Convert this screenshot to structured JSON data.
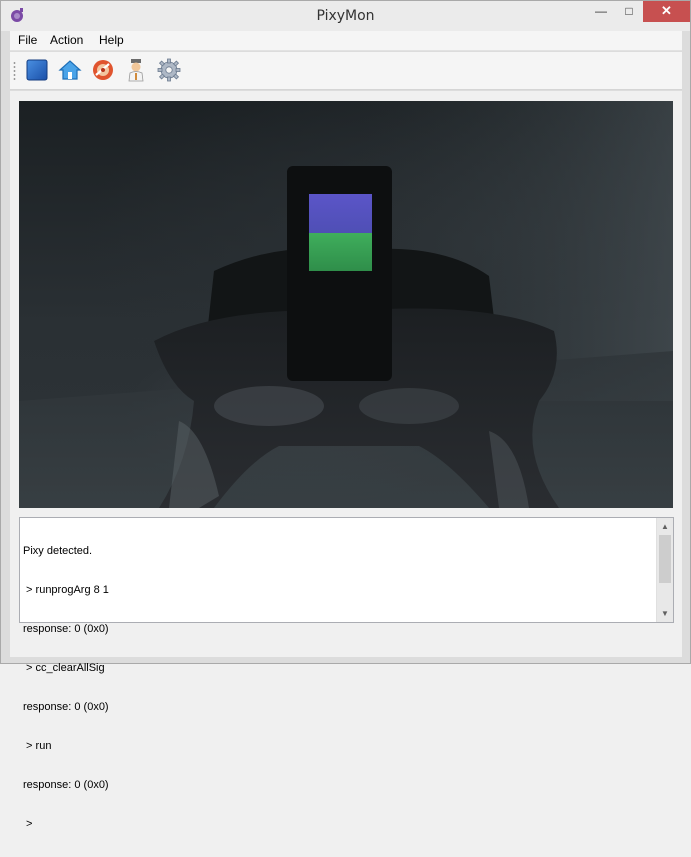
{
  "window": {
    "title": "PixyMon",
    "controls": {
      "minimize": "—",
      "maximize": "□",
      "close": "✕"
    },
    "colors": {
      "close_bg": "#c75050",
      "titlebar_bg": "#ebebeb"
    }
  },
  "menu": {
    "items": [
      {
        "label": "File"
      },
      {
        "label": "Action"
      },
      {
        "label": "Help"
      }
    ]
  },
  "toolbar": {
    "buttons": [
      {
        "icon": "stop-icon",
        "color": "#2266cc"
      },
      {
        "icon": "home-icon",
        "color": "#3b8fd8"
      },
      {
        "icon": "set-signature-icon",
        "color": "#d94f2b"
      },
      {
        "icon": "raw-video-icon",
        "color": "#c89050"
      },
      {
        "icon": "settings-gear-icon",
        "color": "#7a8aa0"
      }
    ]
  },
  "video": {
    "description_colors": {
      "signature_top": "#5b55c8",
      "signature_bottom": "#3fae5c"
    }
  },
  "console": {
    "lines": [
      "Pixy detected.",
      " > runprogArg 8 1",
      "response: 0 (0x0)",
      " > cc_clearAllSig",
      "response: 0 (0x0)",
      " > run",
      "response: 0 (0x0)",
      " > "
    ]
  }
}
